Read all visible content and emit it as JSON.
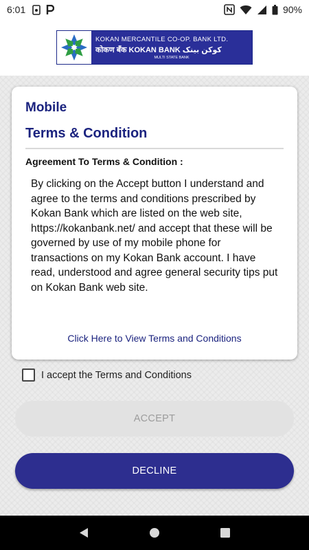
{
  "status_bar": {
    "time": "6:01",
    "battery_percent": "90%",
    "left_icons": [
      "sim-settings-icon",
      "parking-icon"
    ],
    "right_icons": [
      "nfc-icon",
      "wifi-icon",
      "cellular-signal-icon",
      "battery-icon"
    ]
  },
  "header": {
    "logo": {
      "line1": "KOKAN MERCANTILE CO-OP. BANK LTD.",
      "line2_devanagari": "कोकण बँक",
      "line2_english": "KOKAN BANK",
      "line2_urdu": "کوکن بینک",
      "line3": "MULTI STATE BANK",
      "brand_blue": "#2a2f99",
      "mark_green": "#2f9e44",
      "mark_blue": "#2a6cc4"
    }
  },
  "card": {
    "title_line1": "Mobile",
    "title_line2": "Terms & Condition",
    "agreement_heading": "Agreement To Terms & Condition :",
    "agreement_body": "By clicking on the Accept button I understand and agree to the terms and conditions prescribed by Kokan Bank which are listed on the web site, https://kokanbank.net/ and accept that these will be governed by use of my mobile phone for transactions on my Kokan Bank account. I have read, understood and agree general security tips put on Kokan Bank web site.",
    "terms_link": "Click Here to View Terms and Conditions"
  },
  "accept_checkbox": {
    "label": "I accept the Terms and Conditions",
    "checked": false
  },
  "buttons": {
    "accept_label": "ACCEPT",
    "decline_label": "DECLINE"
  },
  "colors": {
    "primary": "#2d2e8f",
    "title_text": "#1b237f",
    "disabled_button": "#e2e2e2",
    "disabled_text": "#9c9c9c"
  },
  "nav_bar": {
    "icons": [
      "back-icon",
      "home-icon",
      "recents-icon"
    ]
  }
}
